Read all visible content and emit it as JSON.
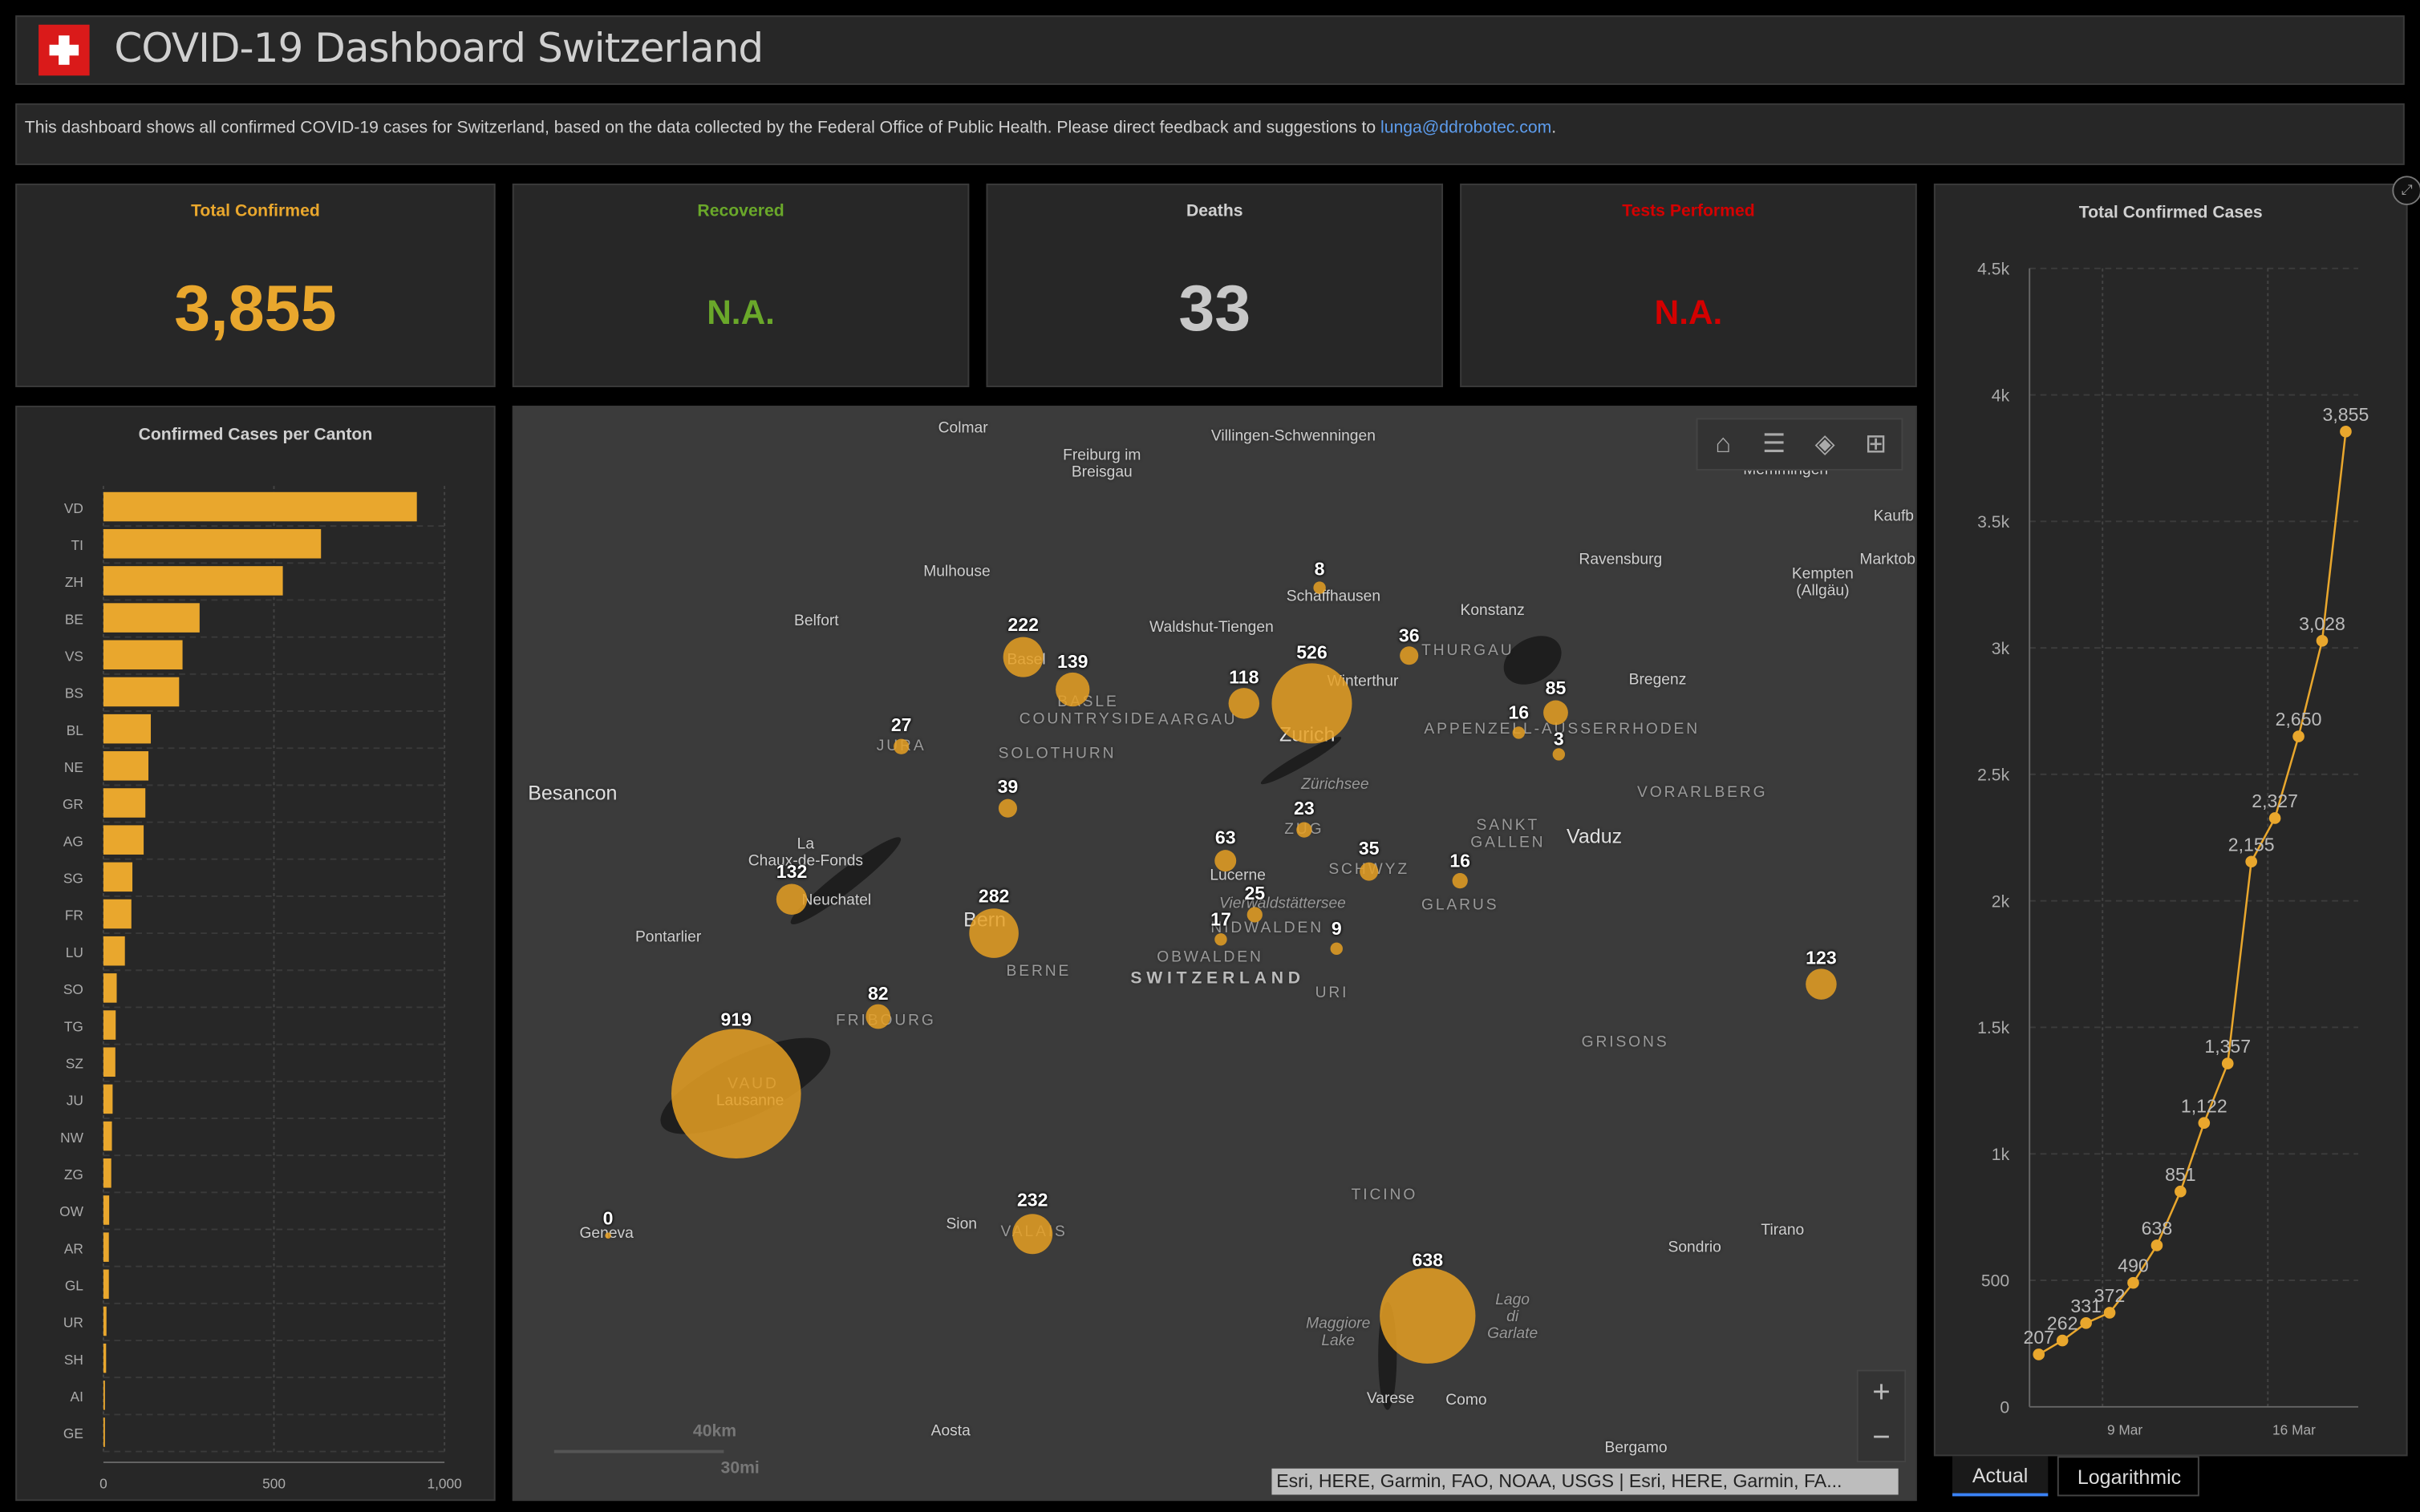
{
  "header": {
    "title": "COVID-19 Dashboard Switzerland",
    "flag_icon": "swiss-flag-icon"
  },
  "description": {
    "text": "This dashboard shows all confirmed COVID-19 cases for Switzerland, based on the data collected by the Federal Office of Public Health. Please direct feedback and suggestions to ",
    "email": "lunga@ddrobotec.com",
    "suffix": "."
  },
  "kpis": [
    {
      "label": "Total Confirmed",
      "value": "3,855",
      "color": "#e9a72d"
    },
    {
      "label": "Recovered",
      "value": "N.A.",
      "color": "#6aa82a"
    },
    {
      "label": "Deaths",
      "value": "33",
      "color": "#c8c8c8"
    },
    {
      "label": "Tests Performed",
      "value": "N.A.",
      "color": "#d40000"
    }
  ],
  "colors": {
    "accent": "#e9a72d",
    "link": "#5d9cec",
    "panel": "#272727"
  },
  "chart_data": [
    {
      "type": "bar",
      "orientation": "horizontal",
      "title": "Confirmed Cases per Canton",
      "categories": [
        "VD",
        "TI",
        "ZH",
        "BE",
        "VS",
        "BS",
        "BL",
        "NE",
        "GR",
        "AG",
        "SG",
        "FR",
        "LU",
        "SO",
        "TG",
        "SZ",
        "JU",
        "NW",
        "ZG",
        "OW",
        "AR",
        "GL",
        "UR",
        "SH",
        "AI",
        "GE"
      ],
      "values": [
        919,
        638,
        526,
        282,
        232,
        222,
        139,
        132,
        123,
        118,
        85,
        82,
        63,
        39,
        36,
        35,
        27,
        25,
        23,
        17,
        16,
        16,
        9,
        8,
        3,
        0
      ],
      "xlim": [
        0,
        1000
      ],
      "xticks": [
        "0",
        "500",
        "1,000"
      ],
      "grid": true
    },
    {
      "type": "line",
      "title": "Total Confirmed Cases",
      "x": [
        "2020-03-06",
        "2020-03-07",
        "2020-03-08",
        "2020-03-09",
        "2020-03-10",
        "2020-03-11",
        "2020-03-12",
        "2020-03-13",
        "2020-03-14",
        "2020-03-15",
        "2020-03-16",
        "2020-03-17",
        "2020-03-18",
        "2020-03-19"
      ],
      "values": [
        207,
        262,
        331,
        372,
        490,
        638,
        851,
        1122,
        1357,
        2155,
        2327,
        2650,
        3028,
        3855
      ],
      "labels": [
        "207",
        "262",
        "331",
        "372",
        "490",
        "638",
        "851",
        "1,122",
        "1,357",
        "2,155",
        "2,327",
        "2,650",
        "3,028",
        "3,855"
      ],
      "ylim": [
        0,
        4500
      ],
      "yticks": [
        "0",
        "500",
        "1k",
        "1.5k",
        "2k",
        "2.5k",
        "3k",
        "3.5k",
        "4k",
        "4.5k"
      ],
      "xticks": [
        "9 Mar",
        "16 Mar"
      ],
      "grid": true,
      "color": "#e9a72d"
    }
  ],
  "chart_tabs": [
    {
      "label": "Actual",
      "active": true
    },
    {
      "label": "Logarithmic",
      "active": false
    }
  ],
  "map": {
    "tools": [
      "home-icon",
      "legend-icon",
      "layers-icon",
      "basemap-gallery-icon"
    ],
    "zoom_in": "+",
    "zoom_out": "−",
    "scale_km": "40km",
    "scale_mi": "30mi",
    "attribution": "Esri, HERE, Garmin, FAO, NOAA, USGS | Esri, HERE, Garmin, FA...",
    "bubbles": [
      {
        "canton": "VD",
        "value": "919"
      },
      {
        "canton": "TI",
        "value": "638"
      },
      {
        "canton": "ZH",
        "value": "526"
      },
      {
        "canton": "BE",
        "value": "282"
      },
      {
        "canton": "VS",
        "value": "232"
      },
      {
        "canton": "BS",
        "value": "222"
      },
      {
        "canton": "BL",
        "value": "139"
      },
      {
        "canton": "NE",
        "value": "132"
      },
      {
        "canton": "GR",
        "value": "123"
      },
      {
        "canton": "AG",
        "value": "118"
      },
      {
        "canton": "SG",
        "value": "85"
      },
      {
        "canton": "FR",
        "value": "82"
      },
      {
        "canton": "LU",
        "value": "63"
      },
      {
        "canton": "SO",
        "value": "39"
      },
      {
        "canton": "TG",
        "value": "36"
      },
      {
        "canton": "SZ",
        "value": "35"
      },
      {
        "canton": "JU",
        "value": "27"
      },
      {
        "canton": "NW",
        "value": "25"
      },
      {
        "canton": "ZG",
        "value": "23"
      },
      {
        "canton": "OW",
        "value": "17"
      },
      {
        "canton": "AR",
        "value": "16"
      },
      {
        "canton": "GL",
        "value": "16"
      },
      {
        "canton": "UR",
        "value": "9"
      },
      {
        "canton": "SH",
        "value": "8"
      },
      {
        "canton": "AI",
        "value": "3"
      },
      {
        "canton": "GE",
        "value": "0"
      }
    ],
    "places": [
      "Colmar",
      "Freiburg im\nBreisgau",
      "Villingen-Schwenningen",
      "Memmingen",
      "Kaufb",
      "Marktob",
      "Ravensburg",
      "Kempten\n(Allgäu)",
      "Mulhouse",
      "Belfort",
      "Schaffhausen",
      "Konstanz",
      "Waldshut-Tiengen",
      "THURGAU",
      "Basel",
      "Winterthur",
      "Bregenz",
      "BASLE\nCOUNTRYSIDE",
      "AARGAU",
      "Zurich",
      "APPENZELL-AUSSERRHODEN",
      "JURA",
      "SOLOTHURN",
      "Besancon",
      "VORARLBERG",
      "Zürichsee",
      "ZUG",
      "SANKT\nGALLEN",
      "Vaduz",
      "La\nChaux-de-Fonds",
      "Neuchatel",
      "SCHWYZ",
      "Lucerne",
      "Vierwaldstättersee",
      "GLARUS",
      "NIDWALDEN",
      "Pontarlier",
      "Bern",
      "OBWALDEN",
      "BERNE",
      "SWITZERLAND",
      "URI",
      "FRIBOURG",
      "GRISONS",
      "VAUD",
      "Lausanne",
      "TICINO",
      "Sion",
      "VALAIS",
      "Geneva",
      "Tirano",
      "Sondrio",
      "Lago\ndi\nGarlate",
      "Maggiore\nLake",
      "Varese",
      "Como",
      "Aosta",
      "Bergamo"
    ]
  }
}
